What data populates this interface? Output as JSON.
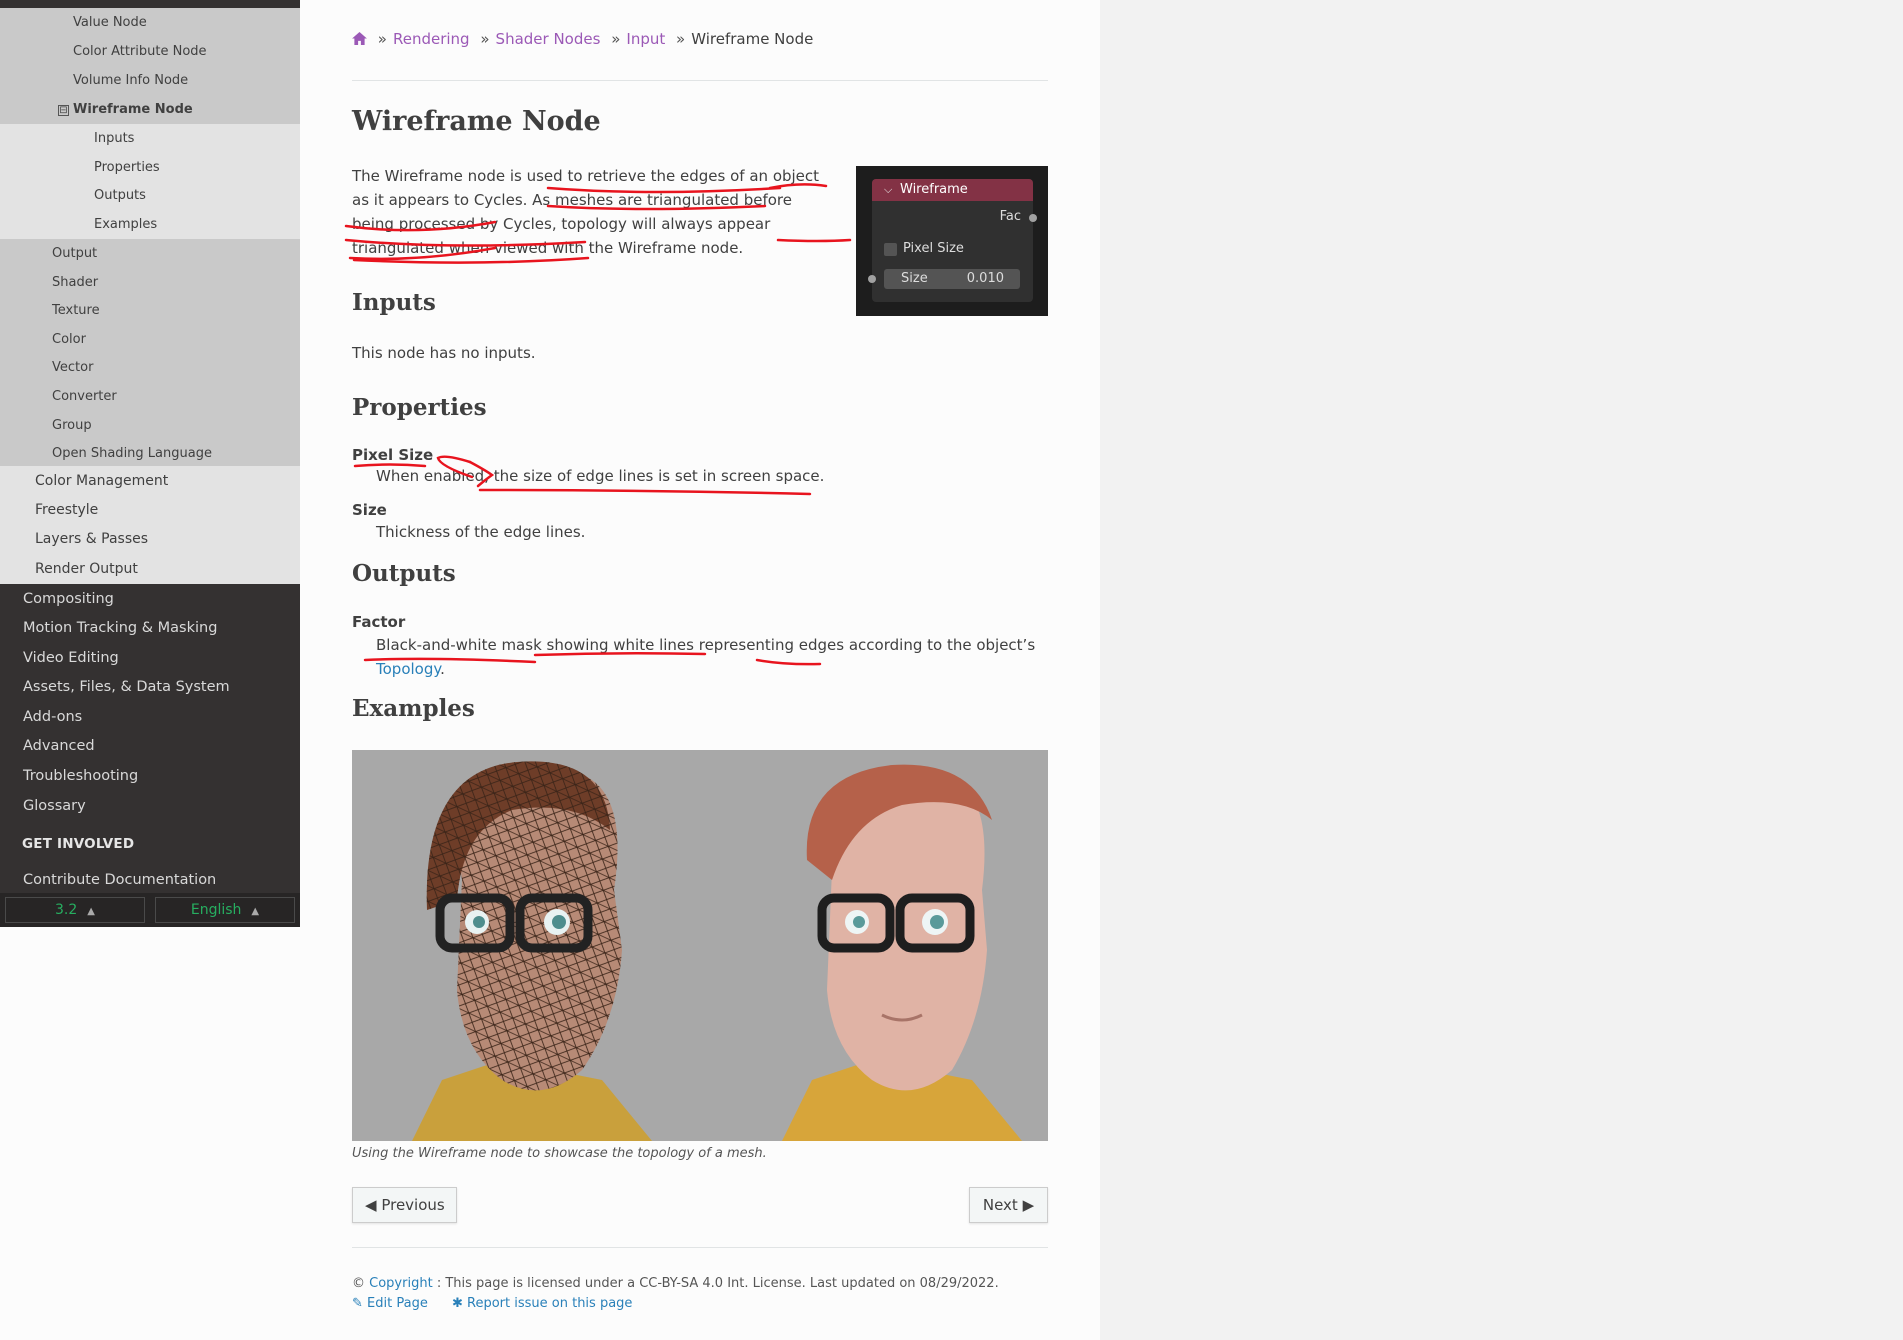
{
  "sidebar": {
    "items_l4_top": [
      "Value Node",
      "Color Attribute Node",
      "Volume Info Node"
    ],
    "current": {
      "toggle": "⊟",
      "label": "Wireframe Node"
    },
    "current_children": [
      "Inputs",
      "Properties",
      "Outputs",
      "Examples"
    ],
    "items_l4_bottom": [
      "Output",
      "Shader",
      "Texture",
      "Color",
      "Vector",
      "Converter",
      "Group",
      "Open Shading Language"
    ],
    "items_l3": [
      "Color Management",
      "Freestyle",
      "Layers & Passes",
      "Render Output"
    ],
    "items_l1": [
      "Compositing",
      "Motion Tracking & Masking",
      "Video Editing",
      "Assets, Files, & Data System",
      "Add-ons",
      "Advanced",
      "Troubleshooting",
      "Glossary"
    ],
    "get_involved": "GET INVOLVED",
    "contribute": "Contribute Documentation",
    "version": "3.2",
    "language": "English"
  },
  "breadcrumbs": {
    "home_icon": "home-icon",
    "items": [
      "Rendering",
      "Shader Nodes",
      "Input"
    ],
    "current": "Wireframe Node",
    "separator": "»"
  },
  "page": {
    "title": "Wireframe Node",
    "intro": "The Wireframe node is used to retrieve the edges of an object as it appears to Cycles. As meshes are triangulated before being processed by Cycles, topology will always appear triangulated when viewed with the Wireframe node.",
    "inputs_heading": "Inputs",
    "inputs_text": "This node has no inputs.",
    "properties_heading": "Properties",
    "prop1_term": "Pixel Size",
    "prop1_desc": "When enabled, the size of edge lines is set in screen space.",
    "prop2_term": "Size",
    "prop2_desc": "Thickness of the edge lines.",
    "outputs_heading": "Outputs",
    "out1_term": "Factor",
    "out1_desc": "Black-and-white mask showing white lines representing edges according to the object’s",
    "out1_link": "Topology",
    "out1_end": ".",
    "examples_heading": "Examples",
    "caption": "Using the Wireframe node to showcase the topology of a mesh."
  },
  "node": {
    "header": "Wireframe",
    "output": "Fac",
    "checkbox_label": "Pixel Size",
    "size_label": "Size",
    "size_value": "0.010",
    "header_color": "#833245"
  },
  "pager": {
    "previous": "Previous",
    "next": "Next"
  },
  "footer": {
    "copyright_symbol": "©",
    "copyright_link": "Copyright",
    "license": ": This page is licensed under a CC-BY-SA 4.0 Int. License. Last updated on 08/29/2022.",
    "edit": "Edit Page",
    "report": "Report issue on this page"
  },
  "colors": {
    "accent_purple": "#9b59b6",
    "link_blue": "#2980b9",
    "sidebar_dark": "#343131",
    "version_green": "#27ae60",
    "annotation_red": "#e8141e"
  }
}
